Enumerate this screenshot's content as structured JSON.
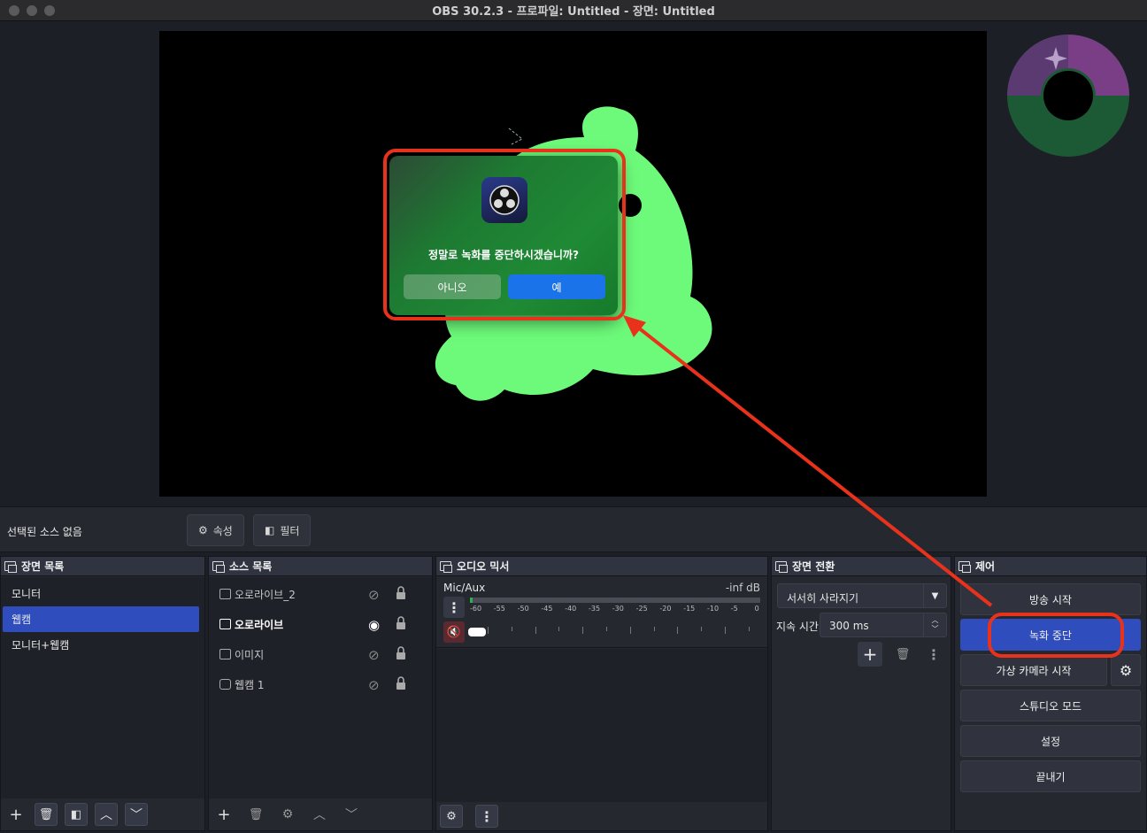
{
  "window": {
    "title": "OBS 30.2.3 - 프로파일: Untitled - 장면: Untitled"
  },
  "properties_bar": {
    "status": "선택된 소스 없음",
    "properties_label": "속성",
    "filters_label": "필터"
  },
  "scenes": {
    "title": "장면 목록",
    "items": [
      "모니터",
      "웹캠",
      "모니터+웹캠"
    ],
    "selected": "웹캠"
  },
  "sources": {
    "title": "소스 목록",
    "items": [
      {
        "label": "오로라이브_2",
        "visible": false
      },
      {
        "label": "오로라이브",
        "visible": true
      },
      {
        "label": "이미지",
        "visible": false
      },
      {
        "label": "웹캠 1",
        "visible": false
      }
    ]
  },
  "mixer": {
    "title": "오디오 믹서",
    "channel": "Mic/Aux",
    "level": "-inf dB",
    "ticks": [
      "-60",
      "-55",
      "-50",
      "-45",
      "-40",
      "-35",
      "-30",
      "-25",
      "-20",
      "-15",
      "-10",
      "-5",
      "0"
    ]
  },
  "transitions": {
    "title": "장면 전환",
    "selected": "서서히 사라지기",
    "duration_label": "지속 시간",
    "duration_value": "300 ms"
  },
  "controls": {
    "title": "제어",
    "start_stream": "방송 시작",
    "stop_recording": "녹화 중단",
    "virtual_camera": "가상 카메라 시작",
    "studio_mode": "스튜디오 모드",
    "settings": "설정",
    "exit": "끝내기"
  },
  "dialog": {
    "message": "정말로 녹화를 중단하시겠습니까?",
    "no_label": "아니오",
    "yes_label": "예"
  },
  "colors": {
    "accent": "#2f4dbd",
    "annotation": "#e8321c",
    "blob": "#6dfa7a",
    "dialog_yes": "#1a73e8"
  }
}
